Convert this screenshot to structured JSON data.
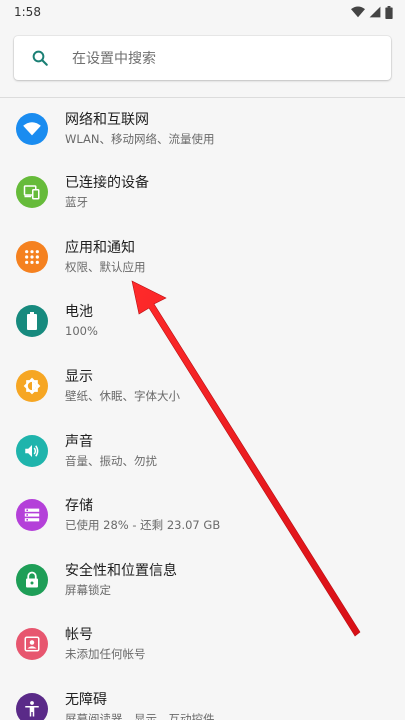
{
  "status_bar": {
    "time": "1:58"
  },
  "search": {
    "placeholder": "在设置中搜索"
  },
  "colors": {
    "wifi": "#1a8cf0",
    "connected": "#66bb3a",
    "apps": "#f5811f",
    "battery": "#178a7e",
    "display": "#f6a623",
    "sound": "#1fb4ac",
    "storage": "#b440d9",
    "security": "#1e9e57",
    "accounts": "#e7566f",
    "accessibility": "#5a2a88",
    "annotation_arrow": "#e8141b"
  },
  "settings": [
    {
      "title": "网络和互联网",
      "summary": "WLAN、移动网络、流量使用",
      "icon": "wifi-icon"
    },
    {
      "title": "已连接的设备",
      "summary": "蓝牙",
      "icon": "connected-devices-icon"
    },
    {
      "title": "应用和通知",
      "summary": "权限、默认应用",
      "icon": "apps-grid-icon"
    },
    {
      "title": "电池",
      "summary": "100%",
      "icon": "battery-icon"
    },
    {
      "title": "显示",
      "summary": "壁纸、休眠、字体大小",
      "icon": "brightness-icon"
    },
    {
      "title": "声音",
      "summary": "音量、振动、勿扰",
      "icon": "volume-icon"
    },
    {
      "title": "存储",
      "summary": "已使用 28% - 还剩 23.07 GB",
      "icon": "storage-icon"
    },
    {
      "title": "安全性和位置信息",
      "summary": "屏幕锁定",
      "icon": "lock-icon"
    },
    {
      "title": "帐号",
      "summary": "未添加任何帐号",
      "icon": "account-icon"
    },
    {
      "title": "无障碍",
      "summary": "屏幕阅读器、显示、互动控件",
      "icon": "accessibility-icon"
    }
  ]
}
